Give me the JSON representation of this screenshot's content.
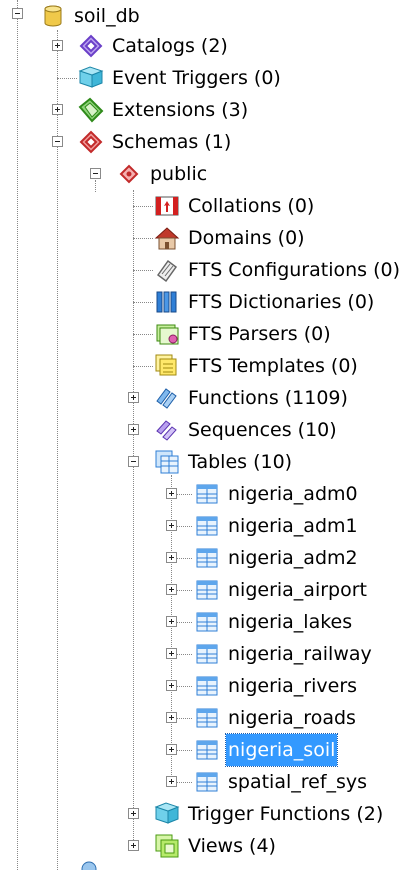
{
  "tree": {
    "database": {
      "label": "soil_db",
      "icon": "database-icon"
    },
    "catalogs": {
      "label": "Catalogs (2)",
      "icon": "catalogs-icon"
    },
    "event_triggers": {
      "label": "Event Triggers (0)",
      "icon": "event-triggers-icon"
    },
    "extensions": {
      "label": "Extensions (3)",
      "icon": "extensions-icon"
    },
    "schemas": {
      "label": "Schemas (1)",
      "icon": "schemas-icon"
    },
    "public": {
      "label": "public",
      "icon": "schema-icon"
    },
    "collations": {
      "label": "Collations (0)",
      "icon": "collations-icon"
    },
    "domains": {
      "label": "Domains (0)",
      "icon": "domains-icon"
    },
    "fts_configurations": {
      "label": "FTS Configurations (0)",
      "icon": "fts-configurations-icon"
    },
    "fts_dictionaries": {
      "label": "FTS Dictionaries (0)",
      "icon": "fts-dictionaries-icon"
    },
    "fts_parsers": {
      "label": "FTS Parsers (0)",
      "icon": "fts-parsers-icon"
    },
    "fts_templates": {
      "label": "FTS Templates (0)",
      "icon": "fts-templates-icon"
    },
    "functions": {
      "label": "Functions (1109)",
      "icon": "functions-icon"
    },
    "sequences": {
      "label": "Sequences (10)",
      "icon": "sequences-icon"
    },
    "tables": {
      "label": "Tables (10)",
      "icon": "tables-icon"
    },
    "table_items": [
      {
        "label": "nigeria_adm0"
      },
      {
        "label": "nigeria_adm1"
      },
      {
        "label": "nigeria_adm2"
      },
      {
        "label": "nigeria_airport"
      },
      {
        "label": "nigeria_lakes"
      },
      {
        "label": "nigeria_railway"
      },
      {
        "label": "nigeria_rivers"
      },
      {
        "label": "nigeria_roads"
      },
      {
        "label": "nigeria_soil",
        "selected": true
      },
      {
        "label": "spatial_ref_sys"
      }
    ],
    "trigger_functions": {
      "label": "Trigger Functions (2)",
      "icon": "trigger-functions-icon"
    },
    "views": {
      "label": "Views (4)",
      "icon": "views-icon"
    }
  },
  "colors": {
    "selection": "#3399ff",
    "selection_text": "#ffffff"
  }
}
